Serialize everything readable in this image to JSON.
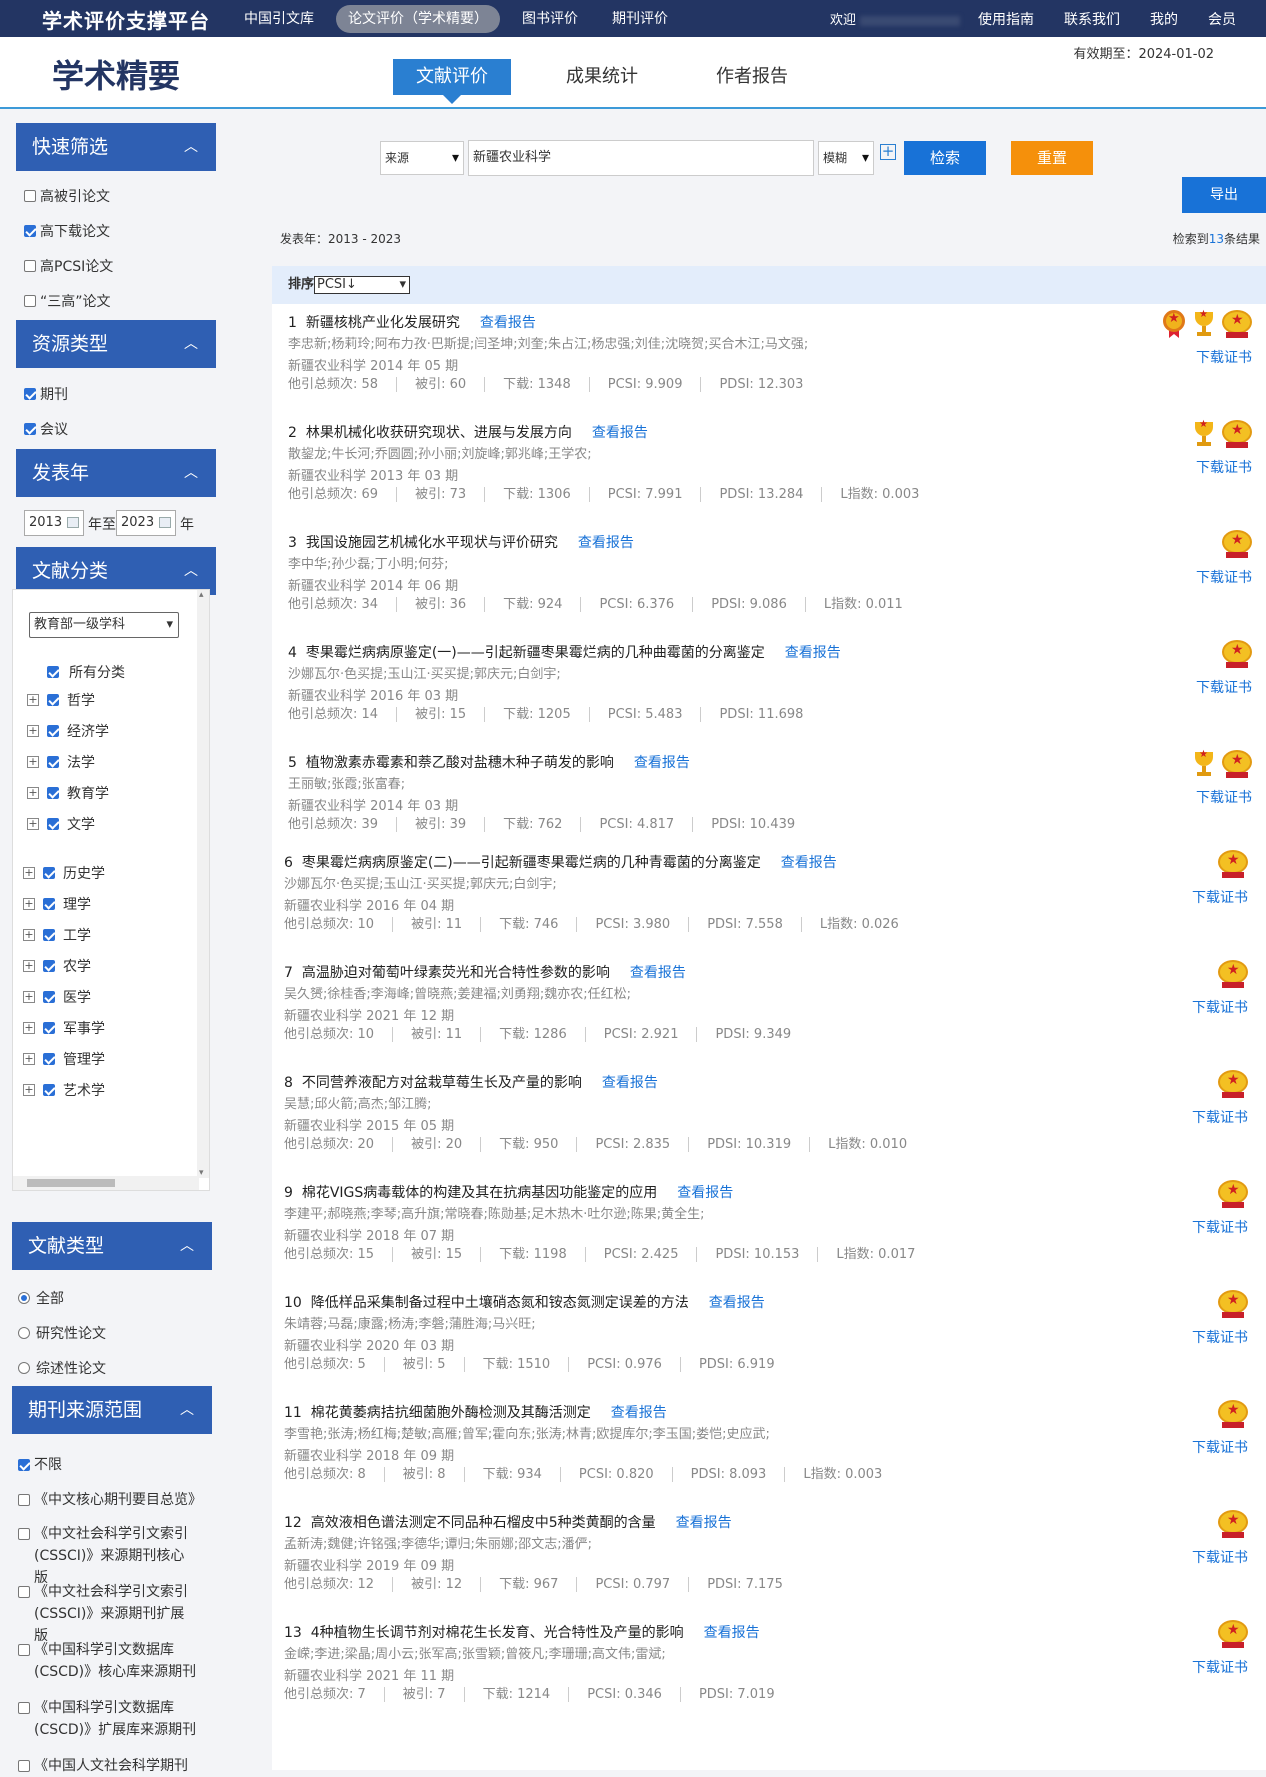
{
  "topbar": {
    "logo": "学术评价支撑平台",
    "nav": [
      "中国引文库",
      "论文评价（学术精要）",
      "图书评价",
      "期刊评价"
    ],
    "welcome": "欢迎",
    "links": [
      "使用指南",
      "联系我们",
      "我的",
      "会员"
    ]
  },
  "header": {
    "brand": "学术精要",
    "expire": "有效期至：2024-01-02",
    "tabs": [
      "文献评价",
      "成果统计",
      "作者报告"
    ]
  },
  "sidebar": {
    "quick": {
      "title": "快速筛选",
      "options": [
        {
          "label": "高被引论文",
          "checked": false
        },
        {
          "label": "高下载论文",
          "checked": true
        },
        {
          "label": "高PCSI论文",
          "checked": false
        },
        {
          "label": "“三高”论文",
          "checked": false
        }
      ]
    },
    "resource": {
      "title": "资源类型",
      "options": [
        {
          "label": "期刊",
          "checked": true
        },
        {
          "label": "会议",
          "checked": true
        }
      ]
    },
    "year": {
      "title": "发表年",
      "from": "2013",
      "to_label": "年至",
      "to": "2023",
      "suffix": "年"
    },
    "classification": {
      "title": "文献分类",
      "select": "教育部一级学科",
      "all": "所有分类",
      "items": [
        "哲学",
        "经济学",
        "法学",
        "教育学",
        "文学",
        "历史学",
        "理学",
        "工学",
        "农学",
        "医学",
        "军事学",
        "管理学",
        "艺术学"
      ]
    },
    "doctype": {
      "title": "文献类型",
      "options": [
        {
          "label": "全部",
          "selected": true
        },
        {
          "label": "研究性论文",
          "selected": false
        },
        {
          "label": "综述性论文",
          "selected": false
        }
      ]
    },
    "source_range": {
      "title": "期刊来源范围",
      "options": [
        {
          "label": "不限",
          "checked": true
        },
        {
          "label": "《中文核心期刊要目总览》",
          "checked": false
        },
        {
          "label": "《中文社会科学引文索引(CSSCI)》来源期刊核心版",
          "checked": false
        },
        {
          "label": "《中文社会科学引文索引(CSSCI)》来源期刊扩展版",
          "checked": false
        },
        {
          "label": "《中国科学引文数据库(CSCD)》核心库来源期刊",
          "checked": false
        },
        {
          "label": "《中国科学引文数据库(CSCD)》扩展库来源期刊",
          "checked": false
        },
        {
          "label": "《中国人文社会科学期刊",
          "checked": false
        }
      ]
    }
  },
  "search": {
    "field": "来源",
    "keyword": "新疆农业科学",
    "mode": "模糊",
    "search_button": "检索",
    "reset_button": "重置",
    "export_button": "导出"
  },
  "summary": {
    "year_range": "发表年：2013 - 2023",
    "count_prefix": "检索到",
    "count": "13",
    "count_suffix": "条结果"
  },
  "sort": {
    "label": "排序",
    "value": "PCSI↓"
  },
  "labels": {
    "report": "查看报告",
    "download": "下载证书"
  },
  "results": [
    {
      "no": "1",
      "title": "新疆核桃产业化发展研究",
      "authors": "李忠新;杨莉玲;阿布力孜·巴斯提;闫圣坤;刘奎;朱占江;杨忠强;刘佳;沈晓贺;买合木江;马文强;",
      "source": "新疆农业科学 2014 年 05 期",
      "stats": [
        "他引总频次: 58",
        "被引: 60",
        "下载: 1348",
        "PCSI: 9.909",
        "PDSI: 12.303"
      ],
      "badges": [
        "medal",
        "trophy",
        "gold"
      ]
    },
    {
      "no": "2",
      "title": "林果机械化收获研究现状、进展与发展方向",
      "authors": "散鋆龙;牛长河;乔圆圆;孙小丽;刘旋峰;郭兆峰;王学农;",
      "source": "新疆农业科学 2013 年 03 期",
      "stats": [
        "他引总频次: 69",
        "被引: 73",
        "下载: 1306",
        "PCSI: 7.991",
        "PDSI: 13.284",
        "L指数: 0.003"
      ],
      "badges": [
        "trophy",
        "gold"
      ]
    },
    {
      "no": "3",
      "title": "我国设施园艺机械化水平现状与评价研究",
      "authors": "李中华;孙少磊;丁小明;何芬;",
      "source": "新疆农业科学 2014 年 06 期",
      "stats": [
        "他引总频次: 34",
        "被引: 36",
        "下载: 924",
        "PCSI: 6.376",
        "PDSI: 9.086",
        "L指数: 0.011"
      ],
      "badges": [
        "gold"
      ]
    },
    {
      "no": "4",
      "title": "枣果霉烂病病原鉴定(一)——引起新疆枣果霉烂病的几种曲霉菌的分离鉴定",
      "authors": "沙娜瓦尔·色买提;玉山江·买买提;郭庆元;白剑宇;",
      "source": "新疆农业科学 2016 年 03 期",
      "stats": [
        "他引总频次: 14",
        "被引: 15",
        "下载: 1205",
        "PCSI: 5.483",
        "PDSI: 11.698"
      ],
      "badges": [
        "gold"
      ]
    },
    {
      "no": "5",
      "title": "植物激素赤霉素和萘乙酸对盐穗木种子萌发的影响",
      "authors": "王丽敏;张霞;张富春;",
      "source": "新疆农业科学 2014 年 03 期",
      "stats": [
        "他引总频次: 39",
        "被引: 39",
        "下载: 762",
        "PCSI: 4.817",
        "PDSI: 10.439"
      ],
      "badges": [
        "trophy",
        "gold"
      ]
    },
    {
      "no": "6",
      "title": "枣果霉烂病病原鉴定(二)——引起新疆枣果霉烂病的几种青霉菌的分离鉴定",
      "authors": "沙娜瓦尔·色买提;玉山江·买买提;郭庆元;白剑宇;",
      "source": "新疆农业科学 2016 年 04 期",
      "stats": [
        "他引总频次: 10",
        "被引: 11",
        "下载: 746",
        "PCSI: 3.980",
        "PDSI: 7.558",
        "L指数: 0.026"
      ],
      "badges": [
        "gold"
      ]
    },
    {
      "no": "7",
      "title": "高温胁迫对葡萄叶绿素荧光和光合特性参数的影响",
      "authors": "吴久赟;徐桂香;李海峰;曾晓燕;姜建福;刘勇翔;魏亦农;任红松;",
      "source": "新疆农业科学 2021 年 12 期",
      "stats": [
        "他引总频次: 10",
        "被引: 11",
        "下载: 1286",
        "PCSI: 2.921",
        "PDSI: 9.349"
      ],
      "badges": [
        "gold"
      ]
    },
    {
      "no": "8",
      "title": "不同营养液配方对盆栽草莓生长及产量的影响",
      "authors": "吴慧;邱火箭;高杰;邹江腾;",
      "source": "新疆农业科学 2015 年 05 期",
      "stats": [
        "他引总频次: 20",
        "被引: 20",
        "下载: 950",
        "PCSI: 2.835",
        "PDSI: 10.319",
        "L指数: 0.010"
      ],
      "badges": [
        "gold"
      ]
    },
    {
      "no": "9",
      "title": "棉花VIGS病毒载体的构建及其在抗病基因功能鉴定的应用",
      "authors": "李建平;郝晓燕;李琴;高升旗;常晓春;陈勋基;足木热木·吐尔逊;陈果;黄全生;",
      "source": "新疆农业科学 2018 年 07 期",
      "stats": [
        "他引总频次: 15",
        "被引: 15",
        "下载: 1198",
        "PCSI: 2.425",
        "PDSI: 10.153",
        "L指数: 0.017"
      ],
      "badges": [
        "gold"
      ]
    },
    {
      "no": "10",
      "title": "降低样品采集制备过程中土壤硝态氮和铵态氮测定误差的方法",
      "authors": "朱靖蓉;马磊;康露;杨涛;李磐;蒲胜海;马兴旺;",
      "source": "新疆农业科学 2020 年 03 期",
      "stats": [
        "他引总频次: 5",
        "被引: 5",
        "下载: 1510",
        "PCSI: 0.976",
        "PDSI: 6.919"
      ],
      "badges": [
        "gold"
      ]
    },
    {
      "no": "11",
      "title": "棉花黄萎病拮抗细菌胞外酶检测及其酶活测定",
      "authors": "李雪艳;张涛;杨红梅;楚敏;高雁;曾军;霍向东;张涛;林青;欧提库尔;李玉国;娄恺;史应武;",
      "source": "新疆农业科学 2018 年 09 期",
      "stats": [
        "他引总频次: 8",
        "被引: 8",
        "下载: 934",
        "PCSI: 0.820",
        "PDSI: 8.093",
        "L指数: 0.003"
      ],
      "badges": [
        "gold"
      ]
    },
    {
      "no": "12",
      "title": "高效液相色谱法测定不同品种石榴皮中5种类黄酮的含量",
      "authors": "孟新涛;魏健;许铭强;李德华;谭归;朱丽娜;邵文志;潘俨;",
      "source": "新疆农业科学 2019 年 09 期",
      "stats": [
        "他引总频次: 12",
        "被引: 12",
        "下载: 967",
        "PCSI: 0.797",
        "PDSI: 7.175"
      ],
      "badges": [
        "gold"
      ]
    },
    {
      "no": "13",
      "title": "4种植物生长调节剂对棉花生长发育、光合特性及产量的影响",
      "authors": "金嵘;李进;梁晶;周小云;张军高;张雪颖;曾筱凡;李珊珊;高文伟;雷斌;",
      "source": "新疆农业科学 2021 年 11 期",
      "stats": [
        "他引总频次: 7",
        "被引: 7",
        "下载: 1214",
        "PCSI: 0.346",
        "PDSI: 7.019"
      ],
      "badges": [
        "gold"
      ]
    }
  ]
}
